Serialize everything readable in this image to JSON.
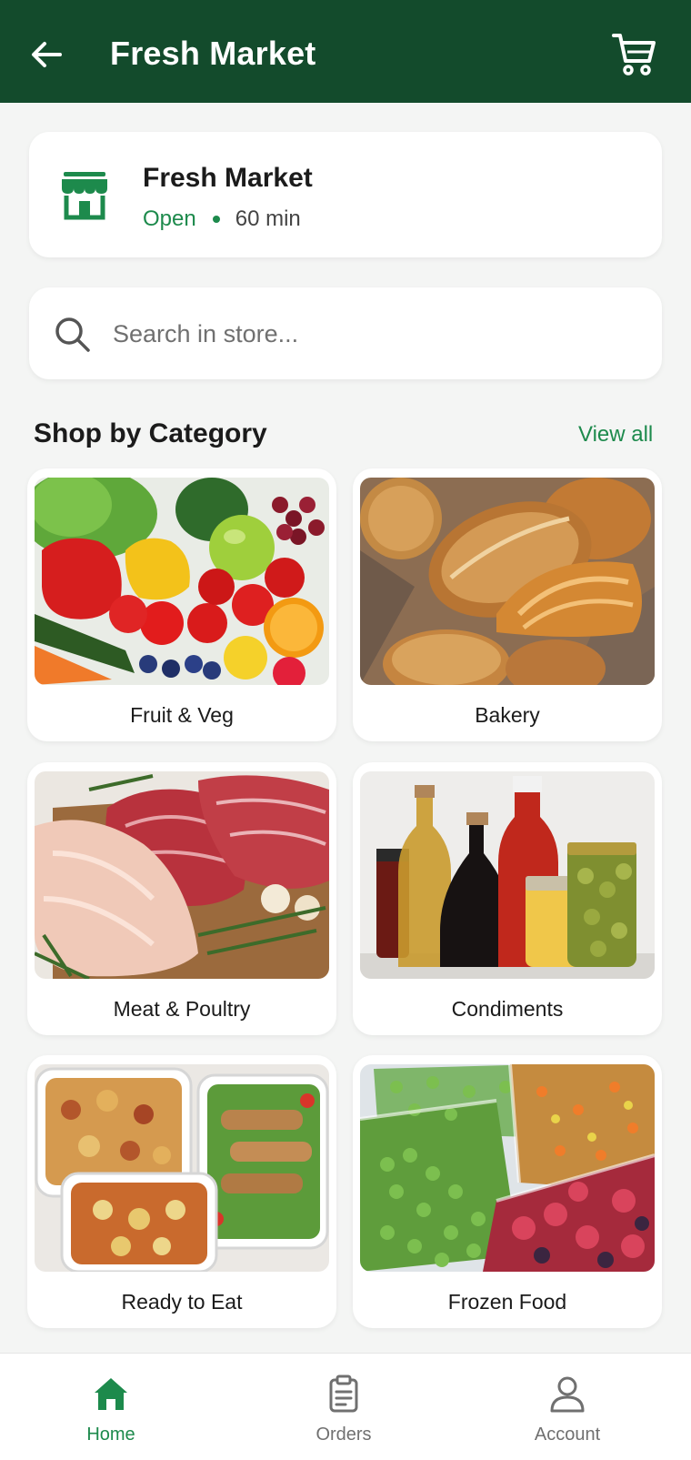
{
  "header": {
    "title": "Fresh Market",
    "back_icon": "arrow-left-icon",
    "cart_icon": "shopping-cart-icon",
    "background": "#134b2c"
  },
  "store": {
    "name": "Fresh Market",
    "status": "Open",
    "delivery_time": "60 min",
    "icon": "storefront-icon",
    "accent": "#1d8a4c"
  },
  "search": {
    "placeholder": "Search in store...",
    "value": "",
    "icon": "search-icon"
  },
  "categories_section": {
    "title": "Shop by Category",
    "view_all_label": "View all",
    "items": [
      {
        "label": "Fruit & Veg",
        "image": "fruit-and-vegetables-photo"
      },
      {
        "label": "Bakery",
        "image": "bread-and-pastries-photo"
      },
      {
        "label": "Meat & Poultry",
        "image": "raw-meat-and-chicken-photo"
      },
      {
        "label": "Condiments",
        "image": "oils-and-sauces-bottles-photo"
      },
      {
        "label": "Ready to Eat",
        "image": "prepared-meals-containers-photo"
      },
      {
        "label": "Frozen Food",
        "image": "frozen-vegetables-bags-photo"
      }
    ]
  },
  "bottom_nav": {
    "items": [
      {
        "label": "Home",
        "icon": "home-icon",
        "active": true
      },
      {
        "label": "Orders",
        "icon": "clipboard-icon",
        "active": false
      },
      {
        "label": "Account",
        "icon": "user-icon",
        "active": false
      }
    ]
  }
}
